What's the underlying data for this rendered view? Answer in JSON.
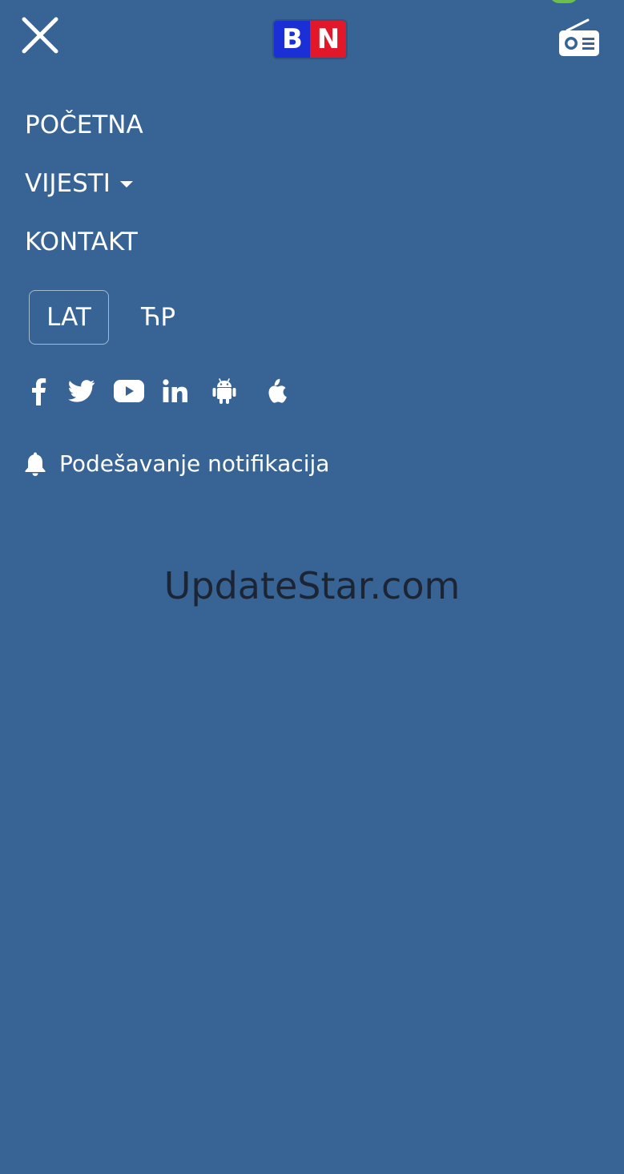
{
  "header": {
    "close_icon": "close-icon",
    "logo": {
      "left": "B",
      "right": "N",
      "left_color": "#1a2fd6",
      "right_color": "#e3172a"
    },
    "radio_icon": "radio-icon"
  },
  "menu": {
    "items": [
      {
        "label": "POČETNA"
      },
      {
        "label": "VIJESTI",
        "has_dropdown": true
      },
      {
        "label": "KONTAKT"
      }
    ]
  },
  "language": {
    "latin": "LAT",
    "cyrillic": "ЋР",
    "selected": "LAT"
  },
  "social": {
    "icons": [
      "facebook-icon",
      "twitter-icon",
      "youtube-icon",
      "linkedin-icon",
      "android-icon",
      "apple-icon"
    ]
  },
  "notifications": {
    "label": "Podešavanje notifikacija",
    "icon": "bell-icon"
  },
  "watermark": {
    "text": "UpdateStar.com"
  },
  "colors": {
    "background": "#386495",
    "text": "#ffffff",
    "watermark": "#1c2534"
  }
}
